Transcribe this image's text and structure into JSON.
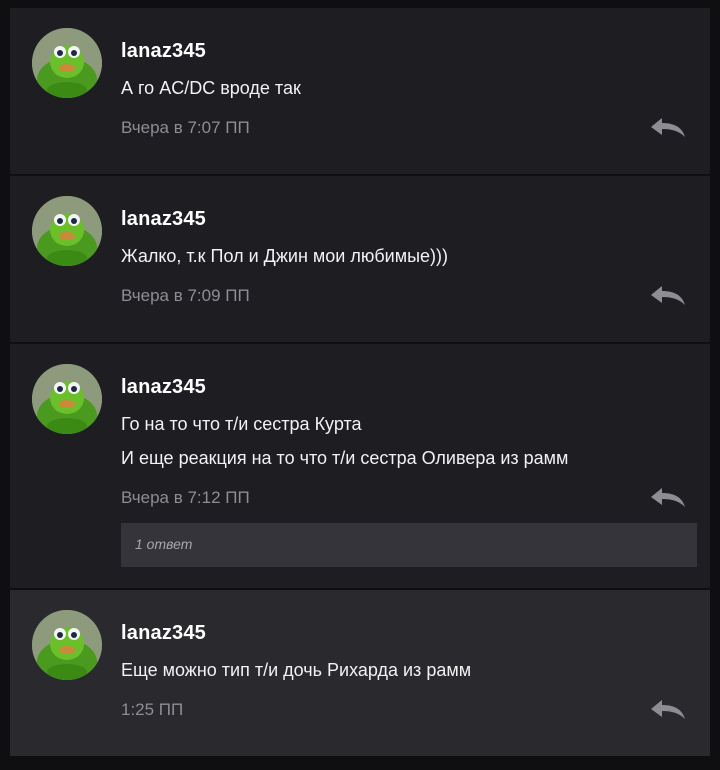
{
  "comments": [
    {
      "username": "lanaz345",
      "lines": [
        "А го AC/DC вроде так"
      ],
      "time": "Вчера в 7:07 ПП"
    },
    {
      "username": "lanaz345",
      "lines": [
        "Жалко, т.к Пол и Джин мои любимые)))"
      ],
      "time": "Вчера в 7:09 ПП"
    },
    {
      "username": "lanaz345",
      "lines": [
        "Го на то что т/и сестра Курта",
        "И еще реакция на то что т/и сестра Оливера из рамм"
      ],
      "time": "Вчера в 7:12 ПП",
      "replies_label": "1 ответ"
    },
    {
      "username": "lanaz345",
      "lines": [
        "Еще можно тип т/и дочь Рихарда из рамм"
      ],
      "time": "1:25 ПП"
    }
  ],
  "colors": {
    "background": "#0f0f11",
    "card": "#1e1d22",
    "card_highlighted": "#2a292e",
    "timestamp": "#8e8d94",
    "reply_icon": "#8e8d94"
  },
  "icons": {
    "reply": "reply-arrow-icon",
    "avatar": "green-frog-avatar"
  }
}
